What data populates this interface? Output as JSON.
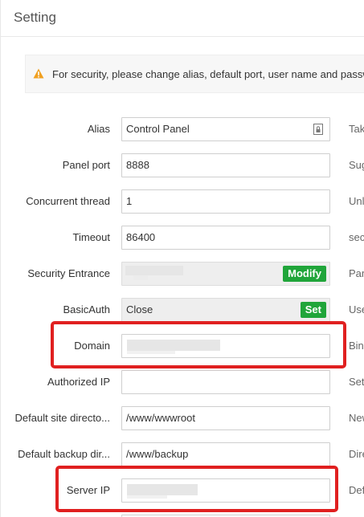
{
  "panel": {
    "title": "Setting"
  },
  "alert": {
    "icon": "warning-icon",
    "text": "For security, please change alias, default port, user name and password"
  },
  "rows": [
    {
      "label": "Alias",
      "value": "Control Panel",
      "hint": "Tak",
      "icon": "document-lock-icon"
    },
    {
      "label": "Panel port",
      "value": "8888",
      "hint": "Sug"
    },
    {
      "label": "Concurrent thread",
      "value": "1",
      "hint": "Unl"
    },
    {
      "label": "Timeout",
      "value": "86400",
      "hint": "sec"
    },
    {
      "label": "Security Entrance",
      "value": "",
      "hint": "Pan",
      "button": "Modify"
    },
    {
      "label": "BasicAuth",
      "value": "Close",
      "hint": "Use",
      "button": "Set"
    },
    {
      "label": "Domain",
      "value": "",
      "hint": "Bin"
    },
    {
      "label": "Authorized IP",
      "value": "",
      "hint": "Set"
    },
    {
      "label": "Default site directo...",
      "value": "/www/wwwroot",
      "hint": "New"
    },
    {
      "label": "Default backup dir...",
      "value": "/www/backup",
      "hint": "Dire"
    },
    {
      "label": "Server IP",
      "value": "",
      "hint": "Def"
    }
  ],
  "colors": {
    "accent": "#20a53a",
    "highlight": "#e02020",
    "warning": "#f0a020"
  }
}
